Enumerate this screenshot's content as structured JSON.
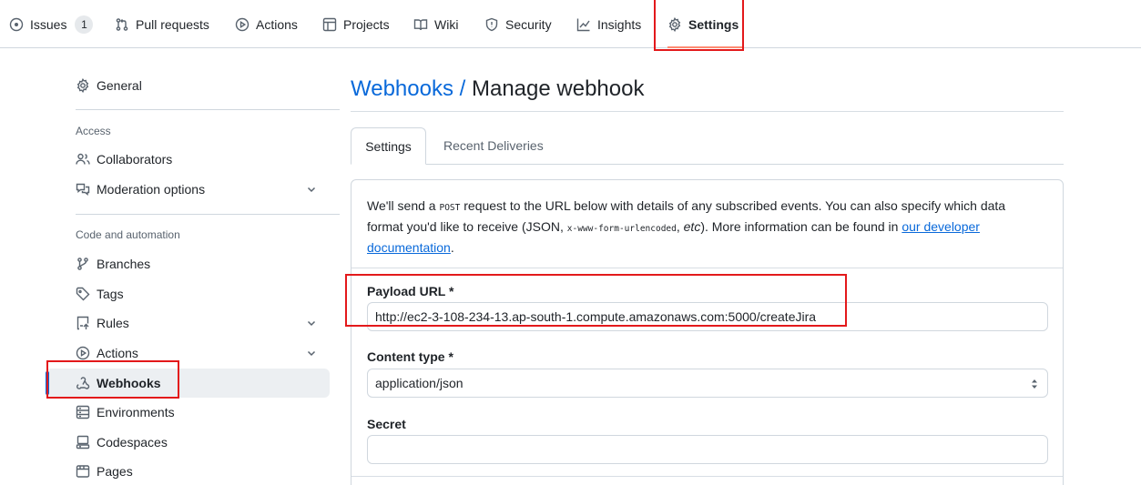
{
  "repo_nav": {
    "issues_label": "Issues",
    "issues_count": "1",
    "pull_requests_label": "Pull requests",
    "actions_label": "Actions",
    "projects_label": "Projects",
    "wiki_label": "Wiki",
    "security_label": "Security",
    "insights_label": "Insights",
    "settings_label": "Settings"
  },
  "sidebar": {
    "general": "General",
    "access_heading": "Access",
    "collaborators": "Collaborators",
    "moderation": "Moderation options",
    "code_heading": "Code and automation",
    "branches": "Branches",
    "tags": "Tags",
    "rules": "Rules",
    "actions": "Actions",
    "webhooks": "Webhooks",
    "environments": "Environments",
    "codespaces": "Codespaces",
    "pages": "Pages"
  },
  "main": {
    "title_crumb": "Webhooks",
    "title_sep": " / ",
    "title_page": "Manage webhook",
    "tabs": [
      {
        "label": "Settings"
      },
      {
        "label": "Recent Deliveries"
      }
    ],
    "intro": {
      "part1": "We'll send a ",
      "post": "POST",
      "part2": " request to the URL below with details of any subscribed events. You can also specify which data format you'd like to receive (JSON, ",
      "urlencoded": "x-www-form-urlencoded",
      "part3": ", ",
      "etc": "etc",
      "part4": "). More information can be found in ",
      "link": "our developer documentation",
      "part5": "."
    },
    "payload_label": "Payload URL *",
    "payload_value": "http://ec2-3-108-234-13.ap-south-1.compute.amazonaws.com:5000/createJira",
    "content_type_label": "Content type *",
    "content_type_value": "application/json",
    "secret_label": "Secret",
    "secret_value": ""
  },
  "colors": {
    "accent": "#0969da",
    "annotation": "#e3191b",
    "tab_underline": "#fd8c73"
  }
}
